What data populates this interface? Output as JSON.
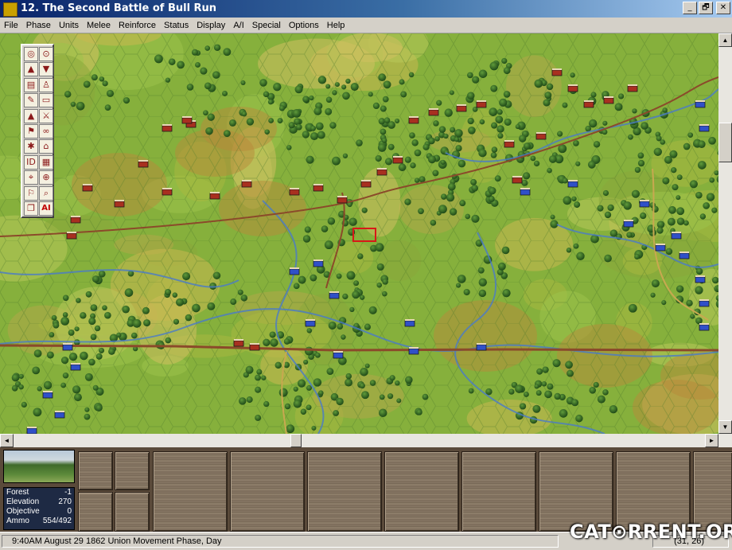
{
  "window": {
    "title": "12. The Second Battle of Bull Run",
    "buttons": [
      "_",
      "🗗",
      "✕"
    ]
  },
  "menu": [
    "File",
    "Phase",
    "Units",
    "Melee",
    "Reinforce",
    "Status",
    "Display",
    "A/I",
    "Special",
    "Options",
    "Help"
  ],
  "toolbar": {
    "tools": [
      {
        "icon": "recenter-icon",
        "glyph": "◎"
      },
      {
        "icon": "find-icon",
        "glyph": "⊙"
      },
      {
        "icon": "move-up-icon",
        "glyph": "▲"
      },
      {
        "icon": "move-down-icon",
        "glyph": "▼"
      },
      {
        "icon": "stack-icon",
        "glyph": "▤"
      },
      {
        "icon": "soldier-icon",
        "glyph": "♙"
      },
      {
        "icon": "orders-icon",
        "glyph": "✎"
      },
      {
        "icon": "ammo-wagon-icon",
        "glyph": "▭"
      },
      {
        "icon": "elevation-icon",
        "glyph": "▲"
      },
      {
        "icon": "fire-icon",
        "glyph": "⚔"
      },
      {
        "icon": "leader-icon",
        "glyph": "⚑"
      },
      {
        "icon": "binoculars-icon",
        "glyph": "∞"
      },
      {
        "icon": "wheel-icon",
        "glyph": "✱"
      },
      {
        "icon": "building-icon",
        "glyph": "⌂"
      },
      {
        "icon": "id-icon",
        "glyph": "ID"
      },
      {
        "icon": "map-icon",
        "glyph": "▦"
      },
      {
        "icon": "target-icon",
        "glyph": "⌖"
      },
      {
        "icon": "crosshair-icon",
        "glyph": "⊕"
      },
      {
        "icon": "flag-icon",
        "glyph": "⚐"
      },
      {
        "icon": "magnifier-icon",
        "glyph": "⌕"
      },
      {
        "icon": "panels-icon",
        "glyph": "❐"
      },
      {
        "icon": "ai-icon",
        "glyph": "AI"
      }
    ]
  },
  "scrollbars": {
    "up": "▲",
    "down": "▼",
    "left": "◄",
    "right": "►"
  },
  "info": {
    "rows": [
      {
        "label": "Forest",
        "value": "-1"
      },
      {
        "label": "Elevation",
        "value": "270"
      },
      {
        "label": "Objective",
        "value": "0"
      },
      {
        "label": "Ammo",
        "value": "554/492"
      }
    ]
  },
  "status": {
    "text": "9:40AM August 29 1862 Union Movement Phase, Day",
    "coords": "(31, 26)"
  },
  "watermark": "CAT⊙RRENT.ORG",
  "colors": {
    "confederate": "#a83020",
    "union": "#3050c8",
    "forest": "#2f5f22",
    "road": "#8b4a2a",
    "stream": "#4a7ac8",
    "selection": "#d81818"
  }
}
